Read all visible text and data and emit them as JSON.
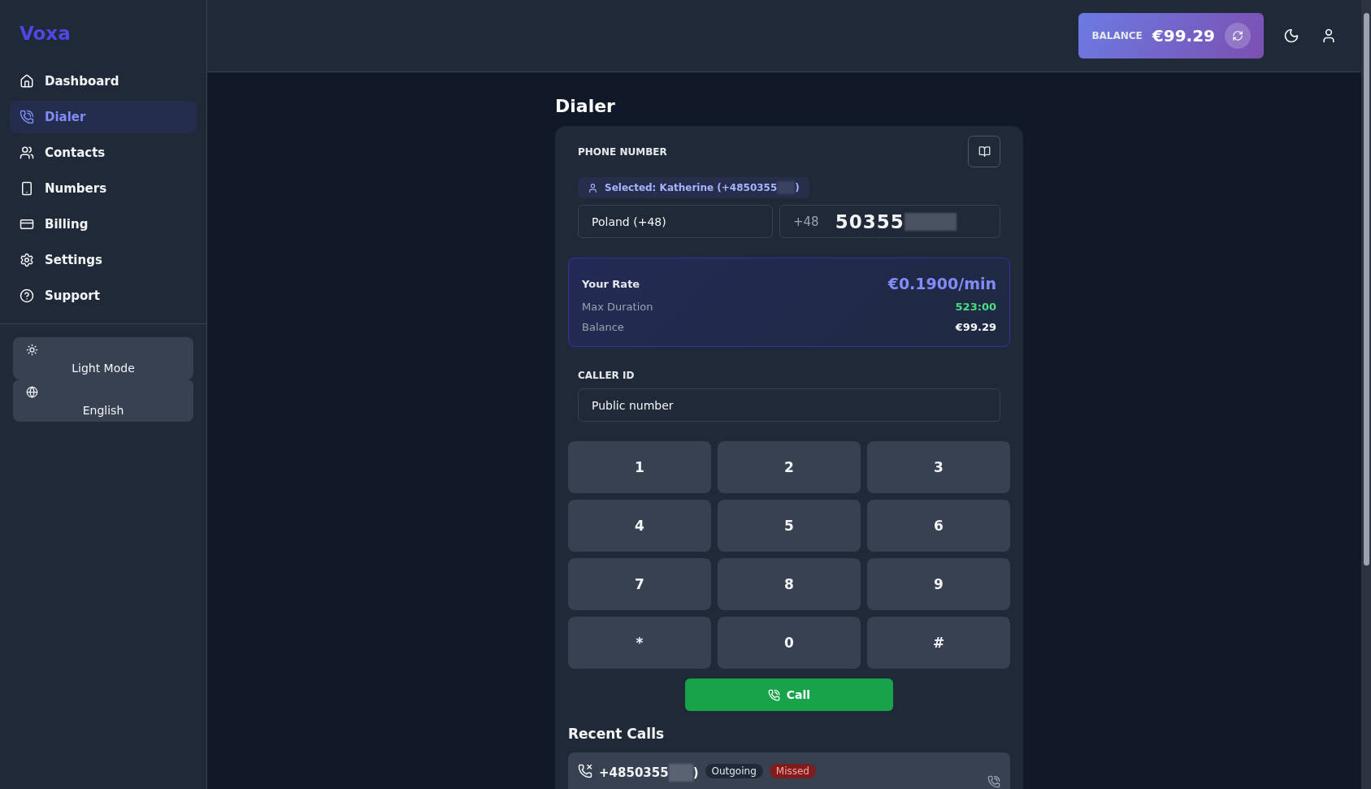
{
  "logo": "Voxa",
  "sidebar": {
    "items": [
      {
        "label": "Dashboard",
        "selected": false
      },
      {
        "label": "Dialer",
        "selected": true
      },
      {
        "label": "Contacts",
        "selected": false
      },
      {
        "label": "Numbers",
        "selected": false
      },
      {
        "label": "Billing",
        "selected": false
      },
      {
        "label": "Settings",
        "selected": false
      },
      {
        "label": "Support",
        "selected": false
      }
    ],
    "preferences": [
      {
        "label": "Light Mode"
      },
      {
        "label": "English"
      }
    ]
  },
  "header": {
    "balance_label": "BALANCE",
    "balance_value": "€99.29"
  },
  "page_title": "Dialer",
  "phone": {
    "label": "PHONE NUMBER",
    "selected_contact": "Selected: Katherine (+4850355",
    "selected_contact_end": ")",
    "country": "Poland (+48)",
    "prefix": "+48",
    "number": "50355",
    "redacted": true
  },
  "rate": {
    "title": "Your Rate",
    "value": "€0.1900/min",
    "rows": [
      {
        "label": "Max Duration",
        "value": "523:00",
        "kind": "positive"
      },
      {
        "label": "Balance",
        "value": "€99.29",
        "kind": "plain"
      }
    ]
  },
  "caller_id": {
    "label": "CALLER ID",
    "value": "Public number"
  },
  "keypad": [
    "1",
    "2",
    "3",
    "4",
    "5",
    "6",
    "7",
    "8",
    "9",
    "*",
    "0",
    "#"
  ],
  "call_button": "Call",
  "recent_calls": {
    "title": "Recent Calls",
    "items": [
      {
        "number": "+4850355",
        "redacted": true,
        "number_end": ")",
        "direction": "Outgoing",
        "status": "Missed",
        "kind": "missed"
      }
    ]
  }
}
